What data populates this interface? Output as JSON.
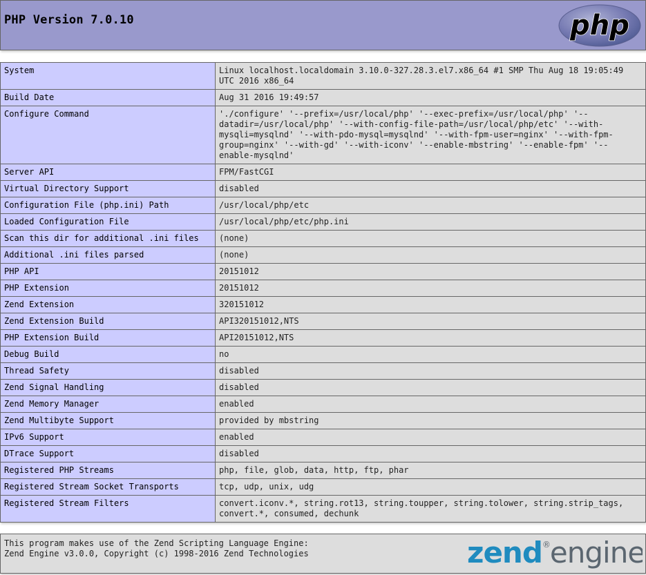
{
  "header": {
    "title": "PHP Version 7.0.10",
    "logo_text": "php"
  },
  "info": [
    {
      "key": "System",
      "value": "Linux localhost.localdomain 3.10.0-327.28.3.el7.x86_64 #1 SMP Thu Aug 18 19:05:49 UTC 2016 x86_64"
    },
    {
      "key": "Build Date",
      "value": "Aug 31 2016 19:49:57"
    },
    {
      "key": "Configure Command",
      "value": "'./configure' '--prefix=/usr/local/php' '--exec-prefix=/usr/local/php' '--datadir=/usr/local/php' '--with-config-file-path=/usr/local/php/etc' '--with-mysqli=mysqlnd' '--with-pdo-mysql=mysqlnd' '--with-fpm-user=nginx' '--with-fpm-group=nginx' '--with-gd' '--with-iconv' '--enable-mbstring' '--enable-fpm' '--enable-mysqlnd'"
    },
    {
      "key": "Server API",
      "value": "FPM/FastCGI"
    },
    {
      "key": "Virtual Directory Support",
      "value": "disabled"
    },
    {
      "key": "Configuration File (php.ini) Path",
      "value": "/usr/local/php/etc"
    },
    {
      "key": "Loaded Configuration File",
      "value": "/usr/local/php/etc/php.ini"
    },
    {
      "key": "Scan this dir for additional .ini files",
      "value": "(none)"
    },
    {
      "key": "Additional .ini files parsed",
      "value": "(none)"
    },
    {
      "key": "PHP API",
      "value": "20151012"
    },
    {
      "key": "PHP Extension",
      "value": "20151012"
    },
    {
      "key": "Zend Extension",
      "value": "320151012"
    },
    {
      "key": "Zend Extension Build",
      "value": "API320151012,NTS"
    },
    {
      "key": "PHP Extension Build",
      "value": "API20151012,NTS"
    },
    {
      "key": "Debug Build",
      "value": "no"
    },
    {
      "key": "Thread Safety",
      "value": "disabled"
    },
    {
      "key": "Zend Signal Handling",
      "value": "disabled"
    },
    {
      "key": "Zend Memory Manager",
      "value": "enabled"
    },
    {
      "key": "Zend Multibyte Support",
      "value": "provided by mbstring"
    },
    {
      "key": "IPv6 Support",
      "value": "enabled"
    },
    {
      "key": "DTrace Support",
      "value": "disabled"
    },
    {
      "key": "Registered PHP Streams",
      "value": "php, file, glob, data, http, ftp, phar"
    },
    {
      "key": "Registered Stream Socket Transports",
      "value": "tcp, udp, unix, udg"
    },
    {
      "key": "Registered Stream Filters",
      "value": "convert.iconv.*, string.rot13, string.toupper, string.tolower, string.strip_tags, convert.*, consumed, dechunk"
    }
  ],
  "footer": {
    "line1": "This program makes use of the Zend Scripting Language Engine:",
    "line2": "Zend Engine v3.0.0, Copyright (c) 1998-2016 Zend Technologies",
    "logo_word1": "zend",
    "logo_mark": "®",
    "logo_word2": "engine"
  },
  "colors": {
    "header_bg": "#9999cc",
    "key_bg": "#ccccff",
    "value_bg": "#dddddd",
    "border": "#666666",
    "zend_blue": "#1f8bbf",
    "zend_gray": "#5b6670"
  }
}
